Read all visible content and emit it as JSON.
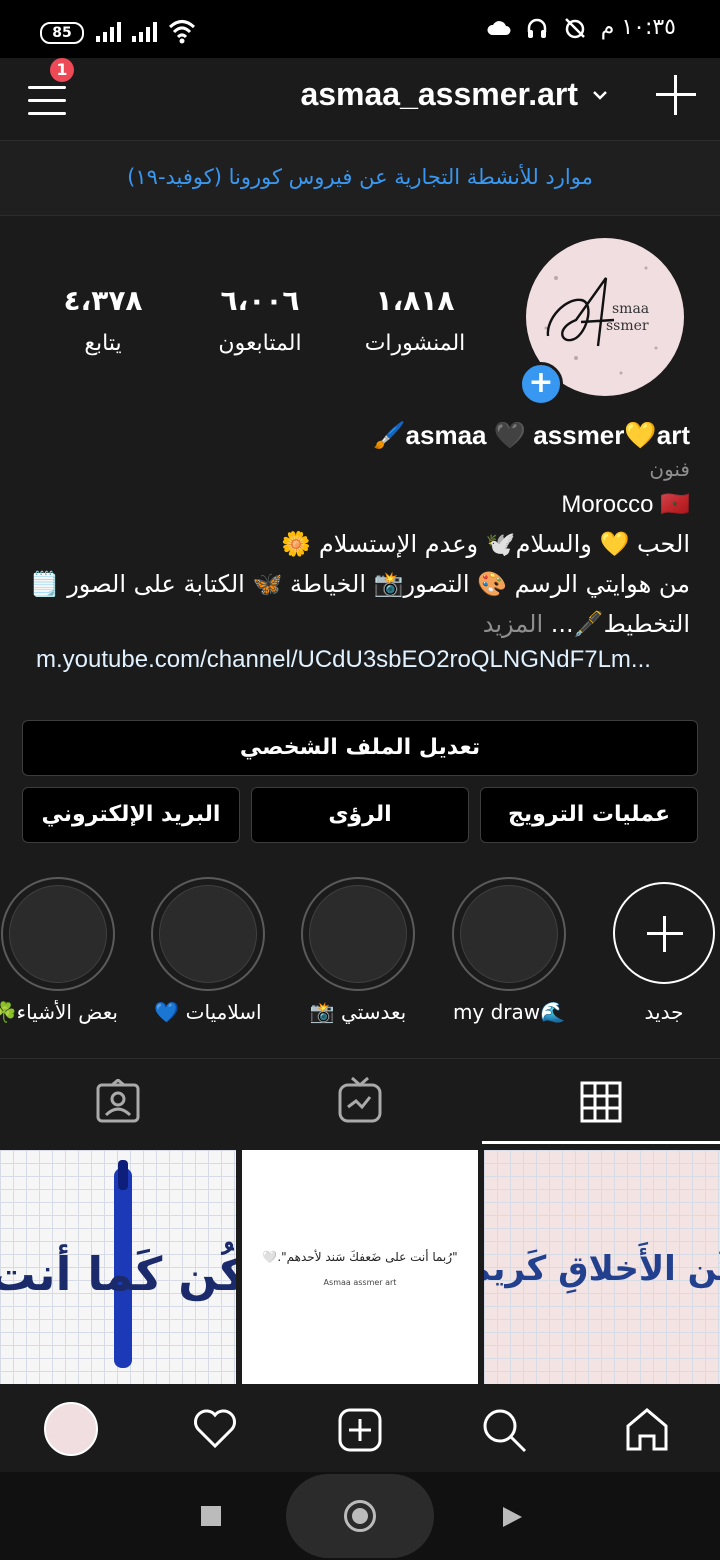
{
  "status_bar": {
    "battery": "85",
    "time": "١٠:٣٥ م"
  },
  "header": {
    "username": "asmaa_assmer.art",
    "notification_count": "1"
  },
  "banner": {
    "text": "موارد للأنشطة التجارية عن فيروس كورونا (كوفيد-١٩)"
  },
  "profile": {
    "avatar_text_1": "smaa",
    "avatar_text_2": "ssmer",
    "stats": [
      {
        "value": "١،٨١٨",
        "label": "المنشورات"
      },
      {
        "value": "٦،٠٠٦",
        "label": "المتابعون"
      },
      {
        "value": "٤،٣٧٨",
        "label": "يتابع"
      }
    ],
    "display_name": "🖌️asmaa 🖤 assmer💛art",
    "category": "فنون",
    "bio_lines": [
      "Morocco 🇲🇦",
      "الحب 💛 والسلام🕊️ وعدم الإستسلام 🌼",
      "من هوايتي الرسم 🎨 التصور📸 الخياطة 🦋 الكتابة على الصور 🗒️"
    ],
    "bio_last": "التخطيط🖋️...",
    "more_label": "المزيد",
    "link": "m.youtube.com/channel/UCdU3sbEO2roQLNGNdF7Lm..."
  },
  "buttons": {
    "edit_profile": "تعديل الملف الشخصي",
    "promotions": "عمليات الترويج",
    "insights": "الرؤى",
    "email": "البريد الإلكتروني"
  },
  "highlights": {
    "new_label": "جديد",
    "items": [
      {
        "label": "my draw🌊"
      },
      {
        "label": "بعدستي 📸"
      },
      {
        "label": "اسلاميات 💙"
      },
      {
        "label": "بعض الأشياء☘️"
      }
    ]
  },
  "posts": {
    "post2_quote": "\"رُبما أنت على ضَعفكَ سَند لأحدهم\".🤍",
    "post2_credit": "Asmaa assmer art",
    "post3_text": "كُن الأَخلاقِ كَريم",
    "post1_text": "كُن كَما أنت"
  }
}
